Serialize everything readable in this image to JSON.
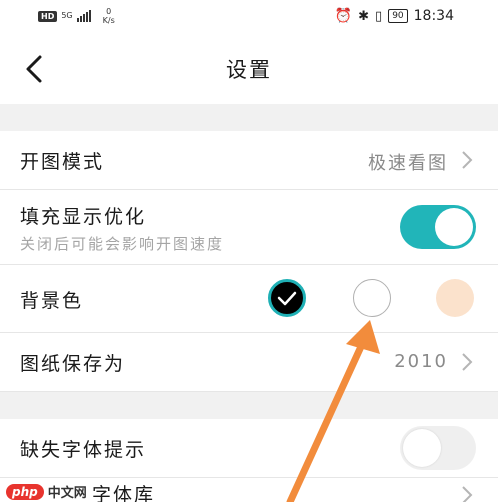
{
  "status_bar": {
    "hd_badge": "HD",
    "network_type": "5G",
    "speed_value": "0",
    "speed_unit": "K/s",
    "battery": "90",
    "time": "18:34"
  },
  "header": {
    "back_icon": "chevron-left-icon",
    "title": "设置"
  },
  "settings": {
    "open_mode": {
      "label": "开图模式",
      "value": "极速看图"
    },
    "fill_display": {
      "label": "填充显示优化",
      "description": "关闭后可能会影响开图速度",
      "enabled": true
    },
    "background": {
      "label": "背景色",
      "options": [
        {
          "color": "#000000",
          "selected": true
        },
        {
          "color": "#ffffff",
          "selected": false
        },
        {
          "color": "#fbe2cc",
          "selected": false
        }
      ]
    },
    "save_as": {
      "label": "图纸保存为",
      "value": "2010"
    },
    "missing_font": {
      "label": "缺失字体提示",
      "enabled": false
    },
    "partial_next_label": "字体库"
  },
  "annotation": {
    "arrow_color": "#f28c3c"
  },
  "watermark": {
    "logo": "php",
    "text": "中文网"
  }
}
